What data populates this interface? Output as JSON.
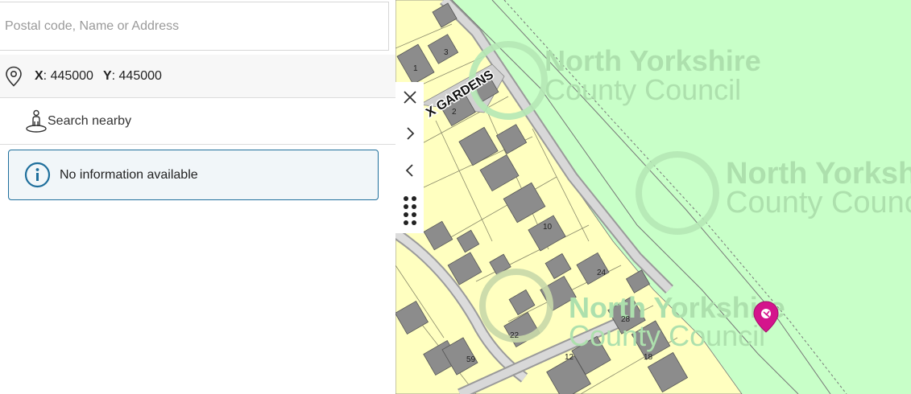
{
  "search": {
    "placeholder": "Postal code, Name or Address",
    "value": ""
  },
  "location": {
    "x_label": "X",
    "x_value": "445000",
    "y_label": "Y",
    "y_value": "445000"
  },
  "nearby": {
    "label": "Search nearby"
  },
  "info": {
    "message": "No information available"
  },
  "map": {
    "street_name": "X GARDENS",
    "watermark_line1": "North Yorkshire",
    "watermark_line2": "County Council",
    "house_numbers": [
      "3",
      "1",
      "2",
      "10",
      "24",
      "28",
      "18",
      "12",
      "22",
      "59"
    ],
    "marker_color": "#d4148c",
    "land_color": "#c8ffc8",
    "plot_color": "#ffffc0",
    "building_color": "#8c8c8c"
  },
  "toolbar": {
    "icons": [
      "close-icon",
      "chevron-right-icon",
      "chevron-left-icon",
      "drag-handle-icon"
    ]
  }
}
